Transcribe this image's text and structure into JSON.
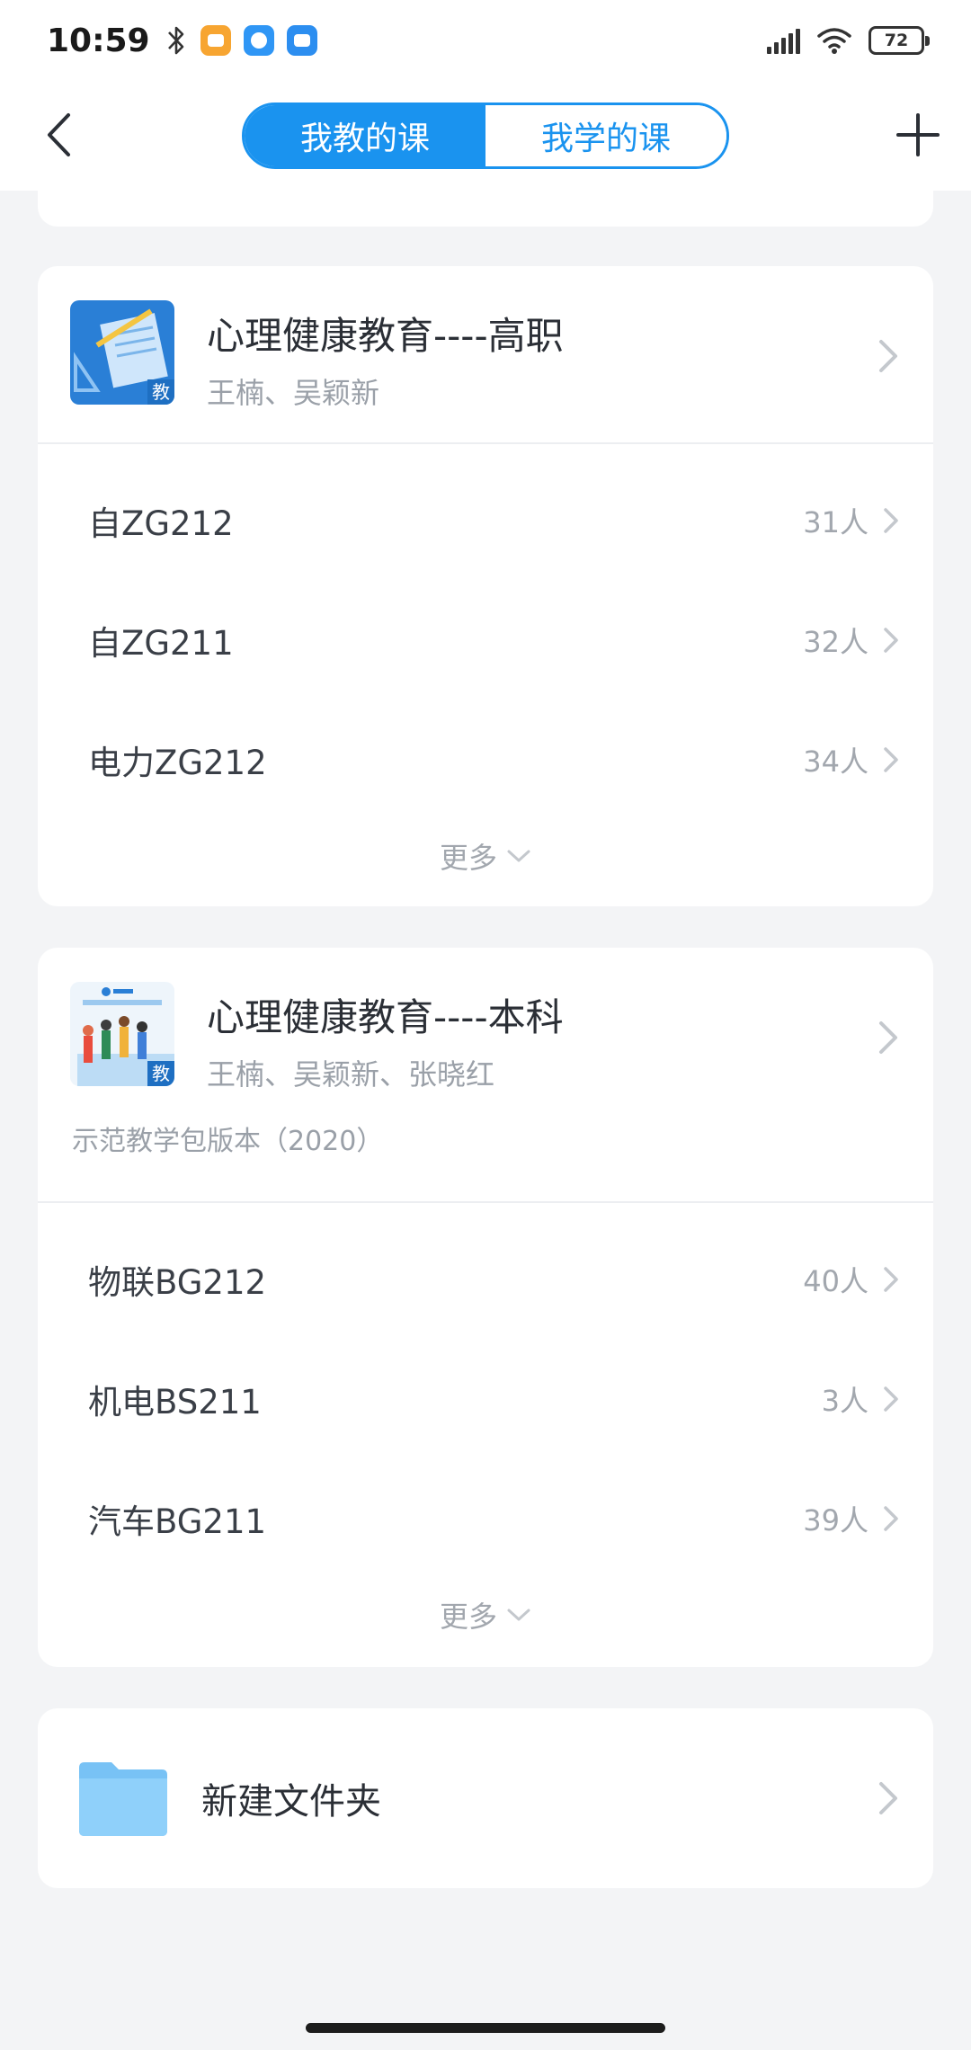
{
  "status_bar": {
    "time": "10:59",
    "battery": "72"
  },
  "nav": {
    "tabs": [
      {
        "label": "我教的课",
        "active": true
      },
      {
        "label": "我学的课",
        "active": false
      }
    ]
  },
  "courses": [
    {
      "title": "心理健康教育----高职",
      "teachers": "王楠、吴颖新",
      "cover_badge": "教",
      "note": "",
      "classes": [
        {
          "name": "自ZG212",
          "count": "31人"
        },
        {
          "name": "自ZG211",
          "count": "32人"
        },
        {
          "name": "电力ZG212",
          "count": "34人"
        }
      ],
      "more_label": "更多"
    },
    {
      "title": "心理健康教育----本科",
      "teachers": "王楠、吴颖新、张晓红",
      "cover_badge": "教",
      "note": "示范教学包版本（2020）",
      "classes": [
        {
          "name": "物联BG212",
          "count": "40人"
        },
        {
          "name": "机电BS211",
          "count": "3人"
        },
        {
          "name": "汽车BG211",
          "count": "39人"
        }
      ],
      "more_label": "更多"
    }
  ],
  "folder": {
    "label": "新建文件夹"
  },
  "colors": {
    "accent": "#1a93ef",
    "background": "#f3f4f6",
    "folder": "#78c2f5"
  }
}
